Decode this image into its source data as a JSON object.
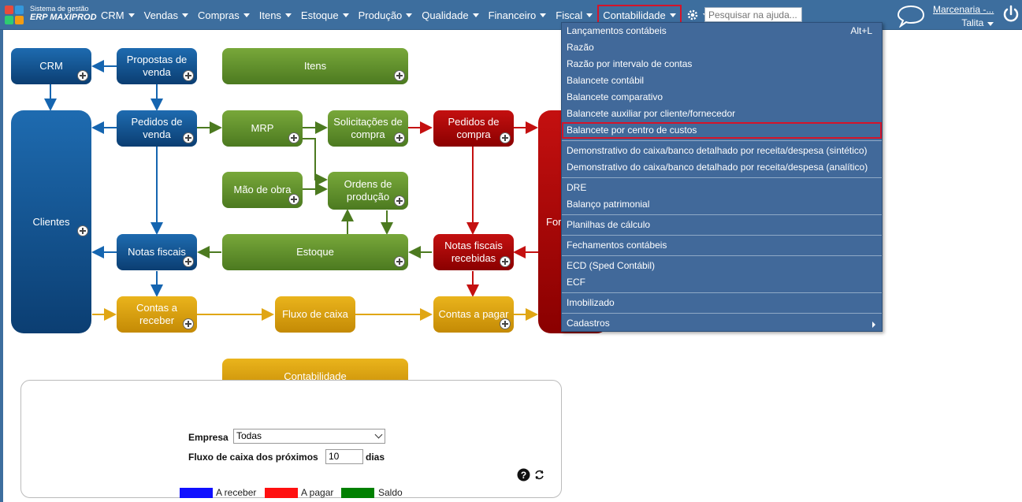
{
  "brand": {
    "line1": "Sistema de gestão",
    "line2": "ERP MAXIPROD"
  },
  "menu": [
    {
      "id": "crm",
      "label": "CRM"
    },
    {
      "id": "vendas",
      "label": "Vendas"
    },
    {
      "id": "compras",
      "label": "Compras"
    },
    {
      "id": "itens",
      "label": "Itens"
    },
    {
      "id": "estoque",
      "label": "Estoque"
    },
    {
      "id": "producao",
      "label": "Produção"
    },
    {
      "id": "qualidade",
      "label": "Qualidade"
    },
    {
      "id": "financeiro",
      "label": "Financeiro"
    },
    {
      "id": "fiscal",
      "label": "Fiscal"
    },
    {
      "id": "contabilidade",
      "label": "Contabilidade"
    }
  ],
  "search": {
    "placeholder": "Pesquisar na ajuda..."
  },
  "user": {
    "company": "Marcenaria -...",
    "name": "Talita"
  },
  "icons": [
    "gear-icon",
    "help-icon",
    "chat-icon",
    "power-icon",
    "plus-icon"
  ],
  "colors": {
    "topbar": "#3d6e9e",
    "highlight": "#d4142a",
    "blue": "#0b3e72",
    "green": "#4c7a20",
    "red": "#8a0000",
    "gold": "#c48a05"
  },
  "flow": {
    "crm": "CRM",
    "propostas": "Propostas de venda",
    "itens": "Itens",
    "clientes": "Clientes",
    "pedidos_venda": "Pedidos de venda",
    "mrp": "MRP",
    "solicitacoes": "Solicitações de compra",
    "pedidos_compra": "Pedidos de compra",
    "fornecedores_partial": "For",
    "mao_obra": "Mão de obra",
    "ordens": "Ordens de produção",
    "notas_fiscais": "Notas fiscais",
    "estoque": "Estoque",
    "nf_recebidas": "Notas fiscais recebidas",
    "contas_receber": "Contas a receber",
    "fluxo_caixa": "Fluxo de caixa",
    "contas_pagar": "Contas a pagar",
    "contabilidade": "Contabilidade"
  },
  "dropdown": {
    "groups": [
      [
        {
          "label": "Lançamentos contábeis",
          "shortcut": "Alt+L"
        },
        {
          "label": "Razão"
        },
        {
          "label": "Razão por intervalo de contas"
        },
        {
          "label": "Balancete contábil"
        },
        {
          "label": "Balancete comparativo"
        },
        {
          "label": "Balancete auxiliar por cliente/fornecedor"
        },
        {
          "label": "Balancete por centro de custos",
          "highlighted": true
        }
      ],
      [
        {
          "label": "Demonstrativo do caixa/banco detalhado por receita/despesa (sintético)"
        },
        {
          "label": "Demonstrativo do caixa/banco detalhado por receita/despesa (analítico)"
        }
      ],
      [
        {
          "label": "DRE"
        },
        {
          "label": "Balanço patrimonial"
        }
      ],
      [
        {
          "label": "Planilhas de cálculo"
        }
      ],
      [
        {
          "label": "Fechamentos contábeis"
        }
      ],
      [
        {
          "label": "ECD (Sped Contábil)"
        },
        {
          "label": "ECF"
        }
      ],
      [
        {
          "label": "Imobilizado"
        }
      ],
      [
        {
          "label": "Cadastros",
          "submenu": true
        }
      ]
    ]
  },
  "panel": {
    "empresa_label": "Empresa",
    "empresa_value": "Todas",
    "fluxo_label": "Fluxo de caixa dos próximos",
    "fluxo_days": "10",
    "fluxo_suffix": "dias",
    "legend": [
      {
        "label": "A receber",
        "color": "#1010ff"
      },
      {
        "label": "A pagar",
        "color": "#ff1010"
      },
      {
        "label": "Saldo",
        "color": "#008000"
      }
    ]
  }
}
